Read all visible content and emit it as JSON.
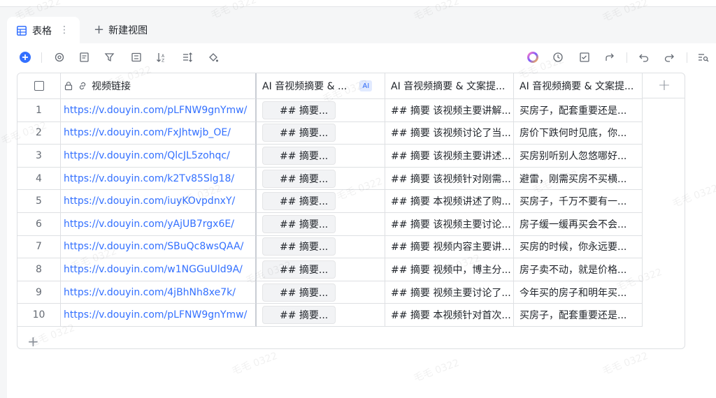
{
  "tabs": {
    "active_label": "表格",
    "more_label": "⋮",
    "new_view_label": "新建视图"
  },
  "toolbar": {
    "add_icon": "plus-circle-icon",
    "colors": {
      "accent": "#3370ff",
      "link": "#3370ff",
      "ai_badge_bg": "#e1eaff"
    }
  },
  "table": {
    "headers": {
      "link": "视频链接",
      "ai_summary": "AI 音视频摘要 & ...",
      "ai_badge": "AI",
      "summary": "AI 音视频摘要 & 文案提...",
      "transcript": "AI 音视频摘要 & 文案提..."
    },
    "rows": [
      {
        "num": "1",
        "link": "https://v.douyin.com/pLFNW9gnYmw/",
        "chip": "## 摘要...",
        "summary": "## 摘要 该视频主要讲解...",
        "transcript": "买房子，配套重要还是..."
      },
      {
        "num": "2",
        "link": "https://v.douyin.com/FxJhtwjb_OE/",
        "chip": "## 摘要...",
        "summary": "## 摘要 该视频讨论了当...",
        "transcript": "房价下跌何时见底，你..."
      },
      {
        "num": "3",
        "link": "https://v.douyin.com/QlcJL5zohqc/",
        "chip": "## 摘要...",
        "summary": "## 摘要 该视频主要讲述...",
        "transcript": "买房别听别人忽悠哪好..."
      },
      {
        "num": "4",
        "link": "https://v.douyin.com/k2Tv85Slg18/",
        "chip": "## 摘要...",
        "summary": "## 摘要 该视频针对刚需...",
        "transcript": "避雷，刚需买房不买横..."
      },
      {
        "num": "5",
        "link": "https://v.douyin.com/iuyKOvpdnxY/",
        "chip": "## 摘要...",
        "summary": "## 摘要 本视频讲述了购...",
        "transcript": "买房子，千万不要有一..."
      },
      {
        "num": "6",
        "link": "https://v.douyin.com/yAjUB7rgx6E/",
        "chip": "## 摘要...",
        "summary": "## 摘要 该视频主要讨论...",
        "transcript": "房子缓一缓再买会不会..."
      },
      {
        "num": "7",
        "link": "https://v.douyin.com/SBuQc8wsQAA/",
        "chip": "## 摘要...",
        "summary": "## 摘要 视频内容主要讲...",
        "transcript": "买房的时候，你永远要..."
      },
      {
        "num": "8",
        "link": "https://v.douyin.com/w1NGGuUld9A/",
        "chip": "## 摘要...",
        "summary": "## 摘要 视频中，博主分...",
        "transcript": "房子卖不动，就是价格..."
      },
      {
        "num": "9",
        "link": "https://v.douyin.com/4jBhNh8xe7k/",
        "chip": "## 摘要...",
        "summary": "## 摘要 视频主要讨论了...",
        "transcript": "今年买的房子和明年买..."
      },
      {
        "num": "10",
        "link": "https://v.douyin.com/pLFNW9gnYmw/",
        "chip": "## 摘要...",
        "summary": "## 摘要 本视频针对首次...",
        "transcript": "买房子，配套重要还是..."
      }
    ]
  },
  "watermark": "毛毛 0322"
}
